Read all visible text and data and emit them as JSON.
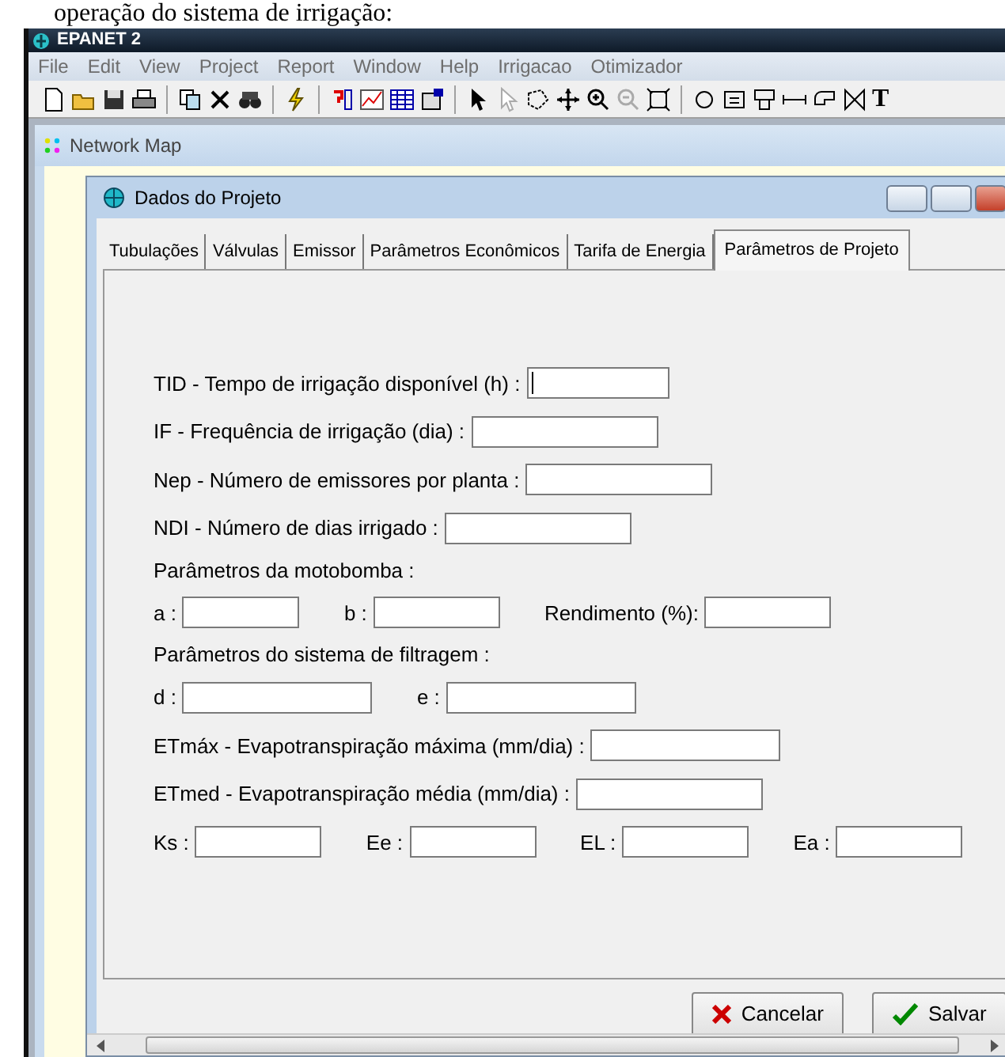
{
  "caption": "operação do sistema de irrigação:",
  "app": {
    "title": "EPANET 2",
    "menu": [
      "File",
      "Edit",
      "View",
      "Project",
      "Report",
      "Window",
      "Help",
      "Irrigacao",
      "Otimizador"
    ],
    "text_tool": "T"
  },
  "map_window": {
    "title": "Network Map"
  },
  "dialog": {
    "title": "Dados do Projeto",
    "tabs": [
      {
        "label": "Tubulações",
        "selected": false
      },
      {
        "label": "Válvulas",
        "selected": false
      },
      {
        "label": "Emissor",
        "selected": false
      },
      {
        "label": "Parâmetros Econômicos",
        "selected": false
      },
      {
        "label": "Tarifa de Energia",
        "selected": false
      },
      {
        "label": "Parâmetros de Projeto",
        "selected": true
      }
    ],
    "rows": [
      {
        "kind": "fields",
        "items": [
          {
            "label": "TID - Tempo de irrigação disponível (h) :",
            "focused": true
          }
        ]
      },
      {
        "kind": "fields",
        "items": [
          {
            "label": "IF - Frequência de irrigação (dia) :",
            "focused": false
          }
        ]
      },
      {
        "kind": "fields",
        "items": [
          {
            "label": "Nep - Número de emissores por planta :",
            "focused": false
          }
        ]
      },
      {
        "kind": "fields",
        "items": [
          {
            "label": "NDI - Número de dias irrigado :",
            "focused": false
          }
        ]
      },
      {
        "kind": "heading",
        "label": "Parâmetros da motobomba :"
      },
      {
        "kind": "fields",
        "items": [
          {
            "label": "a :",
            "focused": false
          },
          {
            "label": "b :",
            "focused": false
          },
          {
            "label": "Rendimento (%):",
            "focused": false
          }
        ]
      },
      {
        "kind": "heading",
        "label": "Parâmetros do sistema de filtragem :"
      },
      {
        "kind": "fields",
        "items": [
          {
            "label": "d :",
            "focused": false
          },
          {
            "label": "e :",
            "focused": false
          }
        ]
      },
      {
        "kind": "fields",
        "items": [
          {
            "label": "ETmáx - Evapotranspiração máxima (mm/dia) :",
            "focused": false
          }
        ]
      },
      {
        "kind": "fields",
        "items": [
          {
            "label": "ETmed - Evapotranspiração média (mm/dia) :",
            "focused": false
          }
        ]
      },
      {
        "kind": "fields",
        "items": [
          {
            "label": "Ks :",
            "focused": false
          },
          {
            "label": "Ee :",
            "focused": false
          },
          {
            "label": "EL :",
            "focused": false
          },
          {
            "label": "Ea :",
            "focused": false
          }
        ]
      }
    ],
    "buttons": [
      {
        "kind": "cancel",
        "label": "Cancelar"
      },
      {
        "kind": "save",
        "label": "Salvar"
      }
    ]
  }
}
